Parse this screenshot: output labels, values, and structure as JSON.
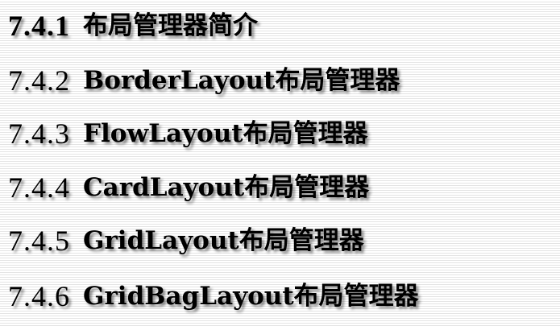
{
  "sections": [
    {
      "number": "7.4.1",
      "title": "布局管理器简介"
    },
    {
      "number": "7.4.2",
      "title": "BorderLayout布局管理器"
    },
    {
      "number": "7.4.3",
      "title": "FlowLayout布局管理器"
    },
    {
      "number": "7.4.4",
      "title": "CardLayout布局管理器"
    },
    {
      "number": "7.4.5",
      "title": "GridLayout布局管理器"
    },
    {
      "number": "7.4.6",
      "title": "GridBagLayout布局管理器"
    }
  ]
}
